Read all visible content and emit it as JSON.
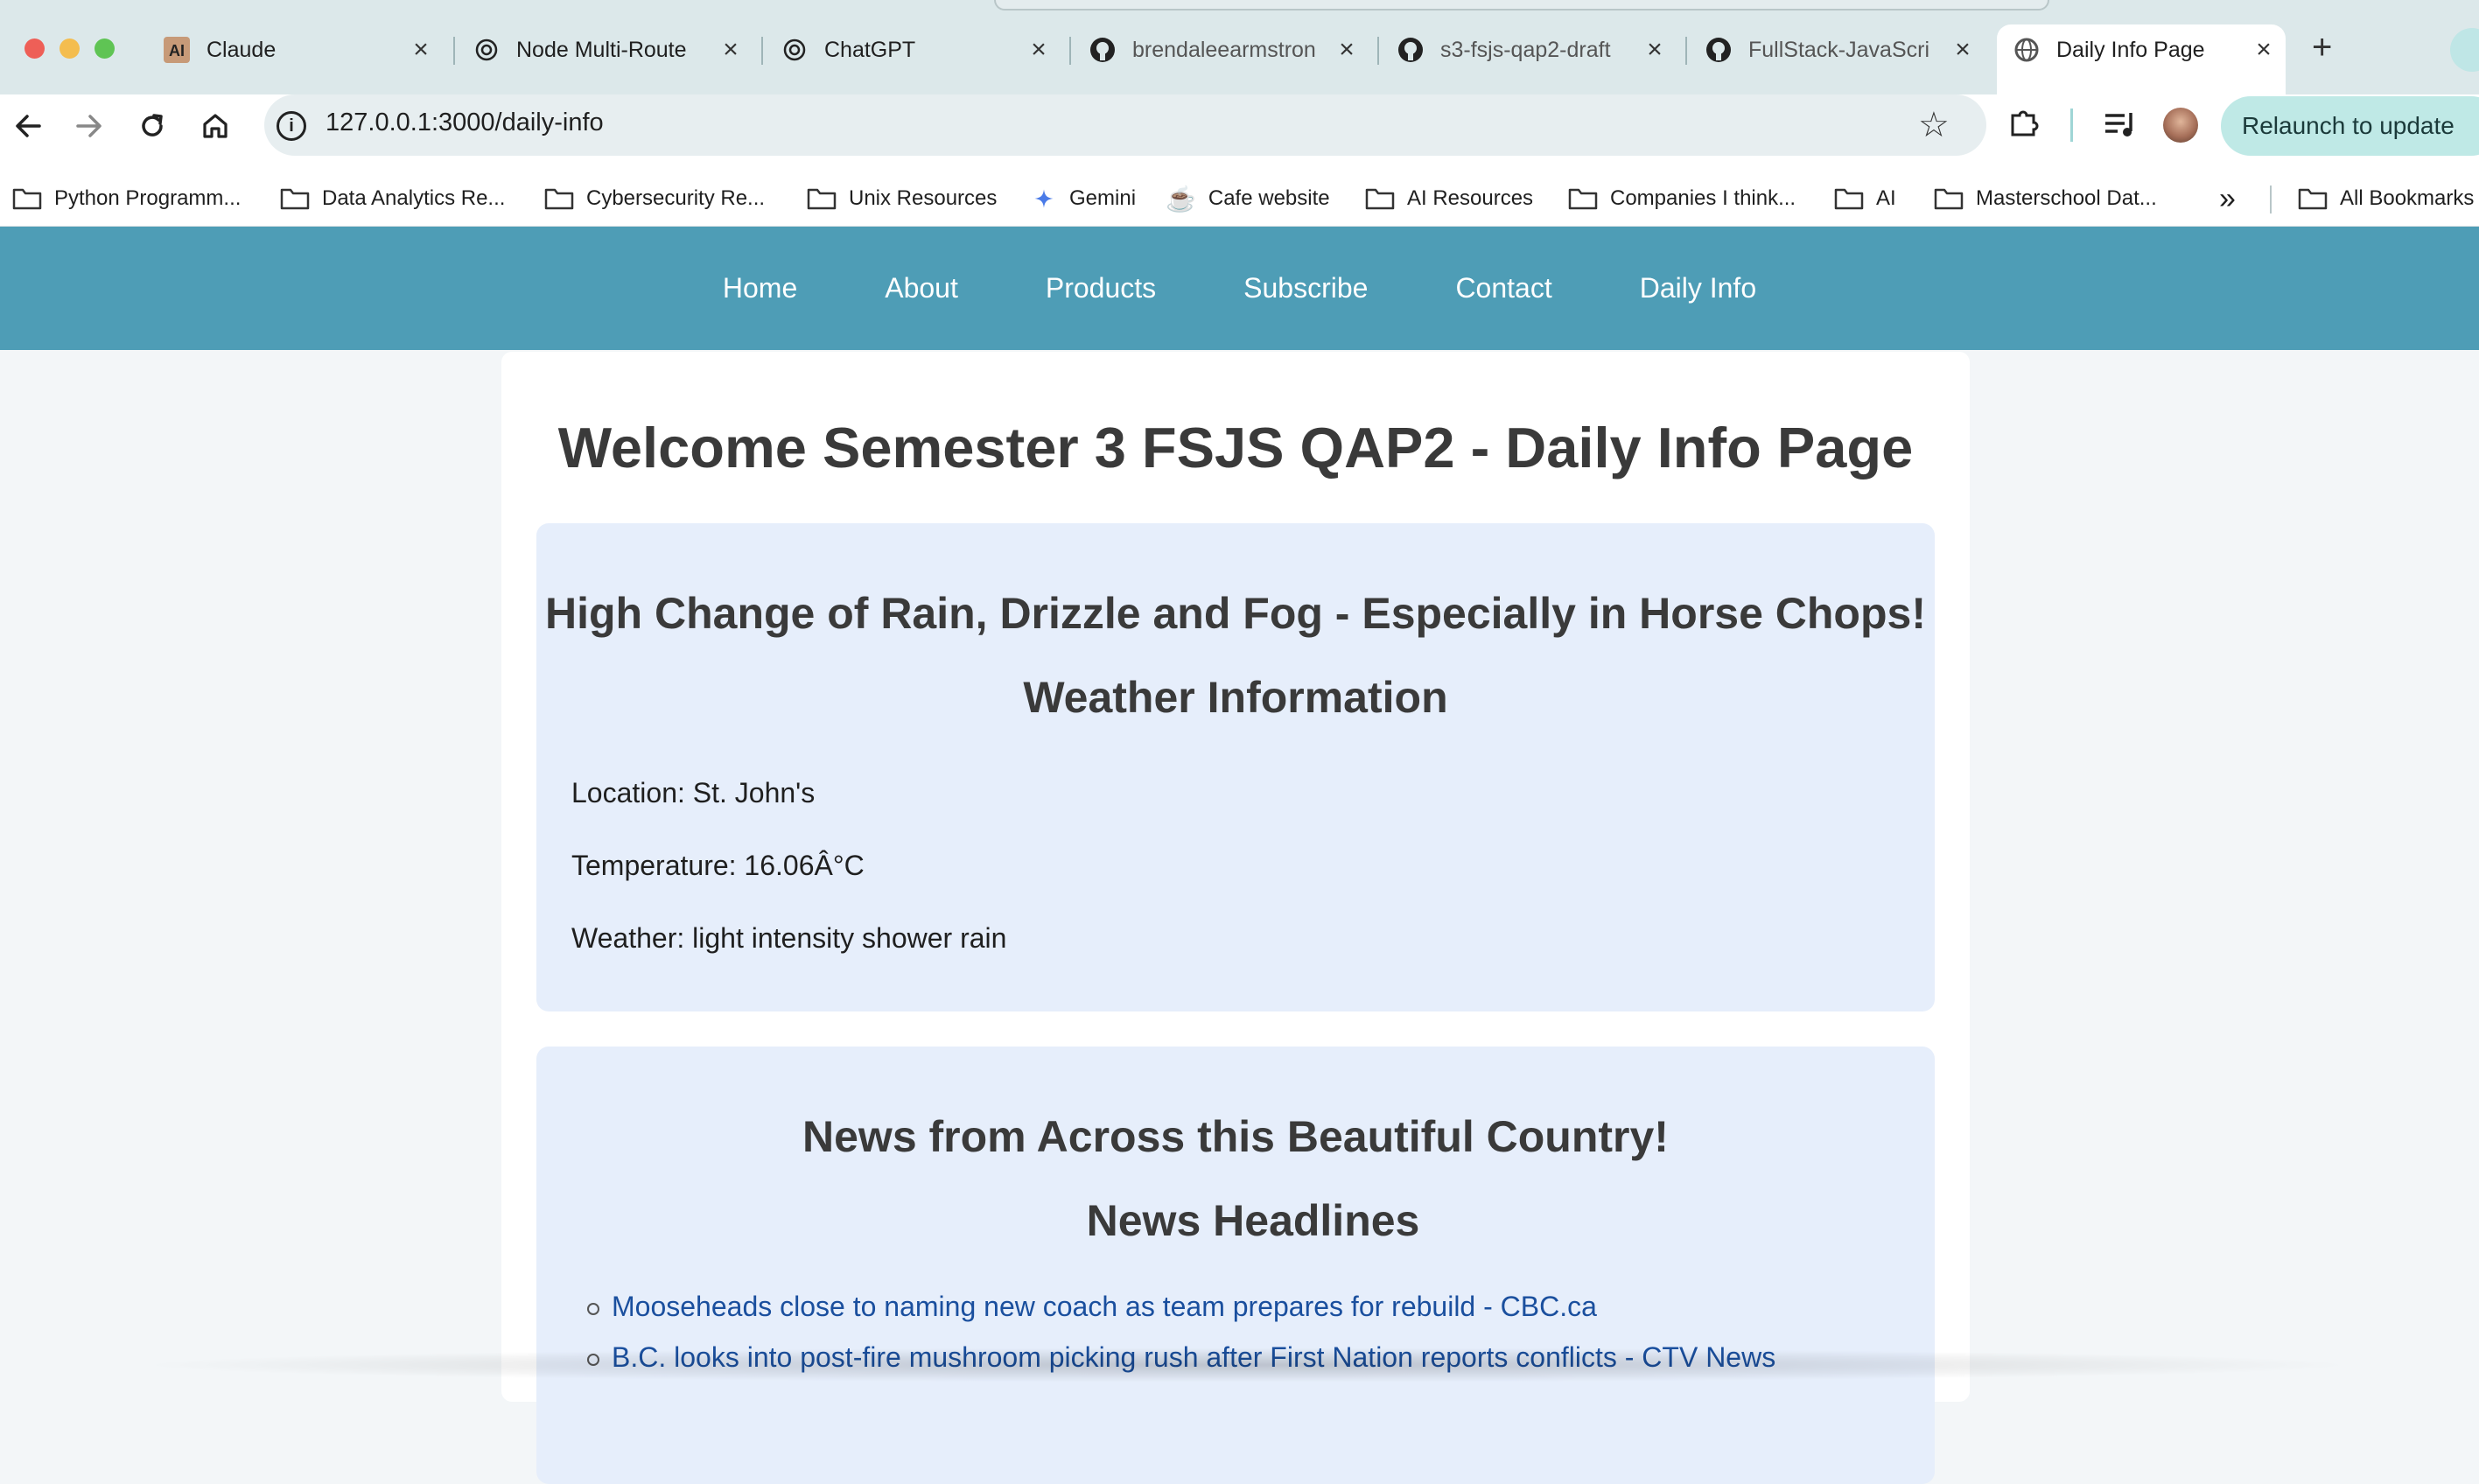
{
  "browser": {
    "tabs": [
      {
        "title": "Claude",
        "icon": "claude-icon"
      },
      {
        "title": "Node Multi-Route",
        "icon": "openai-icon"
      },
      {
        "title": "ChatGPT",
        "icon": "openai-icon"
      },
      {
        "title": "brendaleearmstron",
        "icon": "github-icon"
      },
      {
        "title": "s3-fsjs-qap2-draft",
        "icon": "github-icon"
      },
      {
        "title": "FullStack-JavaScri",
        "icon": "github-icon"
      },
      {
        "title": "Daily Info Page",
        "icon": "globe-icon"
      }
    ],
    "url": "127.0.0.1:3000/daily-info",
    "relaunch_label": "Relaunch to update",
    "bookmarks": [
      "Python Programm...",
      "Data Analytics Re...",
      "Cybersecurity Re...",
      "Unix Resources",
      "Gemini",
      "Cafe website",
      "AI Resources",
      "Companies I think...",
      "AI",
      "Masterschool Dat...",
      "All Bookmarks"
    ],
    "overflow_label": "»"
  },
  "site": {
    "nav": [
      "Home",
      "About",
      "Products",
      "Subscribe",
      "Contact",
      "Daily Info"
    ],
    "title": "Welcome Semester 3 FSJS QAP2 - Daily Info Page",
    "weather": {
      "tagline": "High Change of Rain, Drizzle and Fog - Especially in Horse Chops!",
      "heading": "Weather Information",
      "location": "Location: St. John's",
      "temperature": "Temperature: 16.06Â°C",
      "conditions": "Weather: light intensity shower rain"
    },
    "news": {
      "tagline": "News from Across this Beautiful Country!",
      "heading": "News Headlines",
      "headlines": [
        "Mooseheads close to naming new coach as team prepares for rebuild - CBC.ca",
        "B.C. looks into post-fire mushroom picking rush after First Nation reports conflicts - CTV News"
      ]
    }
  },
  "colors": {
    "nav_bg": "#4e9db6",
    "card_bg": "#e6eefb",
    "link": "#1a4f9e",
    "relaunch_bg": "#bfe9e6"
  }
}
